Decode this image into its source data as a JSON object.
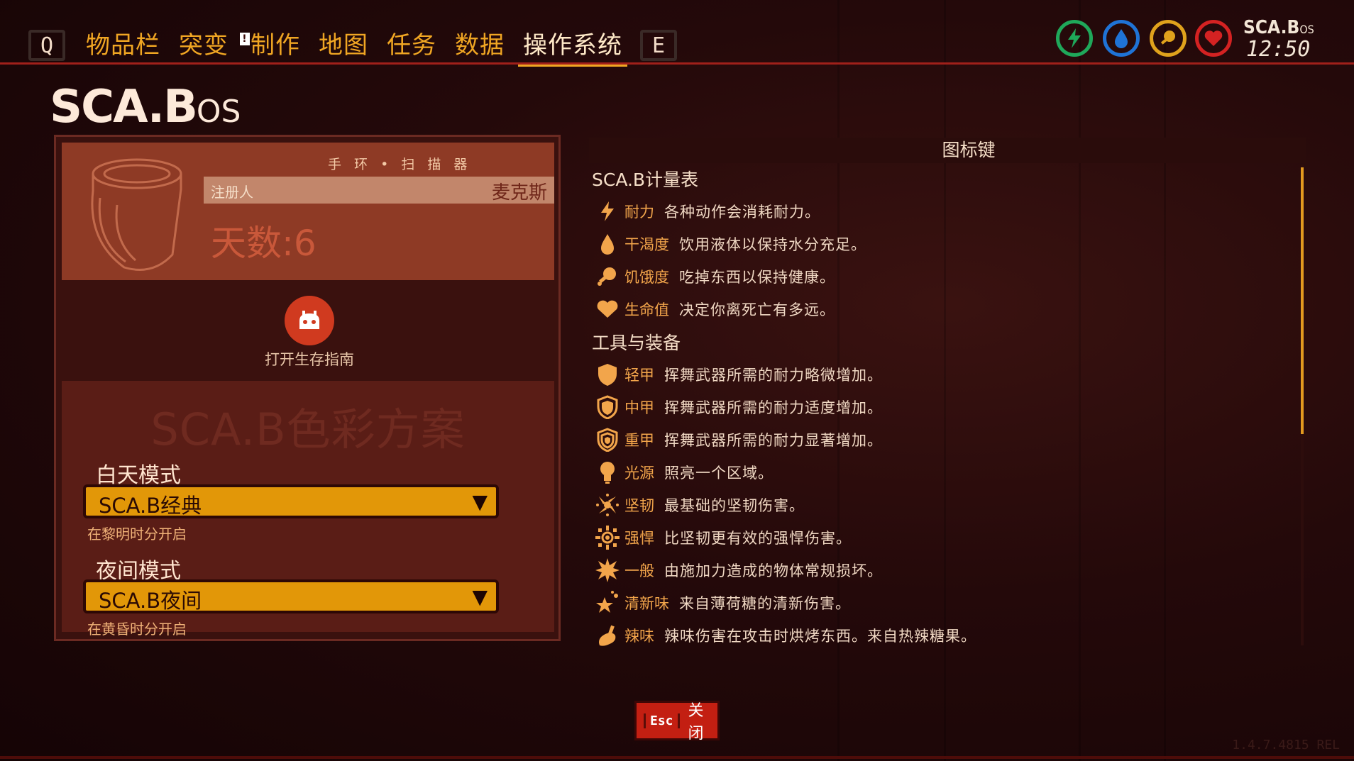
{
  "nav": {
    "left_key": "Q",
    "right_key": "E",
    "tabs": [
      {
        "label": "物品栏"
      },
      {
        "label": "突变"
      },
      {
        "label": "制作",
        "alert": "!"
      },
      {
        "label": "地图"
      },
      {
        "label": "任务"
      },
      {
        "label": "数据"
      },
      {
        "label": "操作系统",
        "active": true
      }
    ]
  },
  "status": {
    "icons": [
      "stamina-icon",
      "thirst-icon",
      "hunger-icon",
      "health-icon"
    ],
    "colors": [
      "#1fa85a",
      "#1f73d6",
      "#e0a21c",
      "#d42222"
    ],
    "os_logo": "SCA.B",
    "os_suffix": "OS",
    "time": "12:50"
  },
  "header": {
    "logo": "SCA.B",
    "logo_suffix": "OS"
  },
  "bracelet": {
    "title": "手 环 • 扫 描 器",
    "registrant_label": "注册人",
    "registrant_name": "麦克斯",
    "days": "天数:6"
  },
  "guide": {
    "label": "打开生存指南"
  },
  "color_scheme": {
    "title": "SCA.B色彩方案",
    "day_label": "白天模式",
    "day_value": "SCA.B经典",
    "day_hint": "在黎明时分开启",
    "night_label": "夜间模式",
    "night_value": "SCA.B夜间",
    "night_hint": "在黄昏时分开启"
  },
  "legend": {
    "title": "图标键",
    "section1": "SCA.B计量表",
    "section2": "工具与装备",
    "items": [
      {
        "icon": "stamina-icon",
        "term": "耐力",
        "desc": "各种动作会消耗耐力。"
      },
      {
        "icon": "thirst-icon",
        "term": "干渴度",
        "desc": "饮用液体以保持水分充足。"
      },
      {
        "icon": "hunger-icon",
        "term": "饥饿度",
        "desc": "吃掉东西以保持健康。"
      },
      {
        "icon": "health-icon",
        "term": "生命值",
        "desc": "决定你离死亡有多远。"
      },
      {
        "icon": "light-armor-icon",
        "term": "轻甲",
        "desc": "挥舞武器所需的耐力略微增加。"
      },
      {
        "icon": "medium-armor-icon",
        "term": "中甲",
        "desc": "挥舞武器所需的耐力适度增加。"
      },
      {
        "icon": "heavy-armor-icon",
        "term": "重甲",
        "desc": "挥舞武器所需的耐力显著增加。"
      },
      {
        "icon": "light-source-icon",
        "term": "光源",
        "desc": "照亮一个区域。"
      },
      {
        "icon": "tough-damage-icon",
        "term": "坚韧",
        "desc": "最基础的坚韧伤害。"
      },
      {
        "icon": "strong-damage-icon",
        "term": "强悍",
        "desc": "比坚韧更有效的强悍伤害。"
      },
      {
        "icon": "general-damage-icon",
        "term": "一般",
        "desc": "由施加力造成的物体常规损坏。"
      },
      {
        "icon": "fresh-damage-icon",
        "term": "清新味",
        "desc": "来自薄荷糖的清新伤害。"
      },
      {
        "icon": "spicy-damage-icon",
        "term": "辣味",
        "desc": "辣味伤害在攻击时烘烤东西。来自热辣糖果。"
      }
    ]
  },
  "footer": {
    "esc_key": "Esc",
    "close_label": "关闭",
    "version": "1.4.7.4815 REL"
  },
  "colors": {
    "accent": "#f0a623",
    "panel": "#8e3a25",
    "dropdown": "#e29708",
    "close": "#c31f12"
  }
}
